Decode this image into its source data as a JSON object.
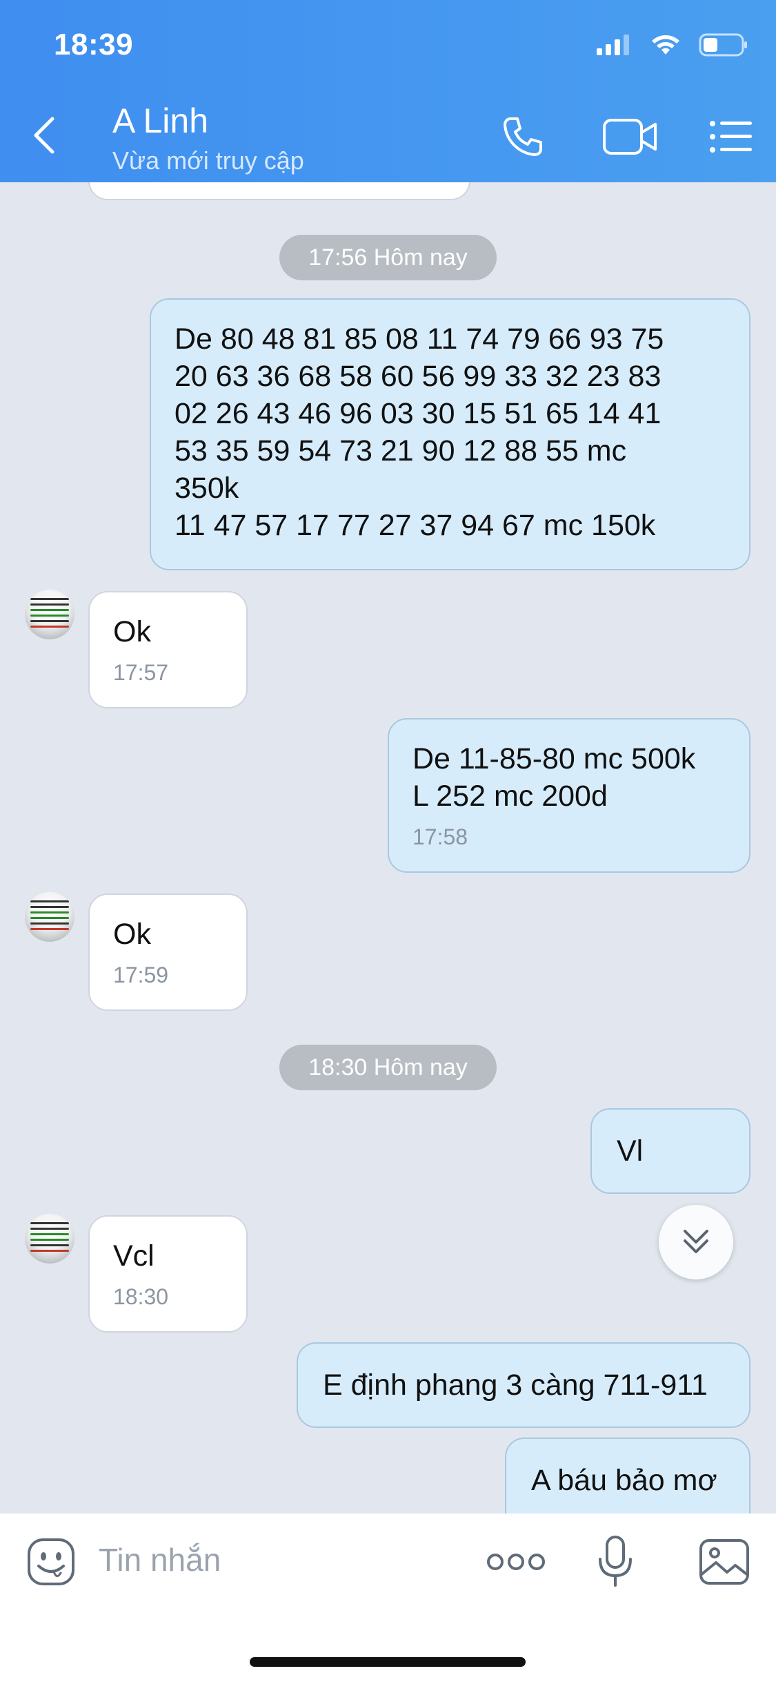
{
  "status_bar": {
    "time": "18:39"
  },
  "header": {
    "name": "A Linh",
    "status": "Vừa mới truy cập"
  },
  "dates": {
    "d1": "17:56 Hôm nay",
    "d2": "18:30 Hôm nay"
  },
  "messages": {
    "m1": {
      "text": "De 80 48 81 85 08 11 74 79 66 93 75\n20 63 36 68 58 60 56 99 33 32 23 83\n02 26 43 46 96 03 30 15 51 65 14 41\n53 35 59 54 73 21 90 12 88 55 mc\n350k\n11 47 57 17 77 27 37 94 67 mc 150k"
    },
    "m2": {
      "text": "Ok",
      "time": "17:57"
    },
    "m3": {
      "text": "De 11-85-80 mc 500k\nL 252 mc 200d",
      "time": "17:58"
    },
    "m4": {
      "text": "Ok",
      "time": "17:59"
    },
    "m5": {
      "text": "Vl"
    },
    "m6": {
      "text": "Vcl",
      "time": "18:30"
    },
    "m7": {
      "text": "E định phang 3 càng 711-911"
    },
    "m8": {
      "text": "A báu bảo mơ"
    }
  },
  "input": {
    "placeholder": "Tin nhắn"
  },
  "icons": {
    "signal": "signal-icon",
    "wifi": "wifi-icon",
    "battery": "battery-icon",
    "back": "back-arrow-icon",
    "call": "phone-icon",
    "video": "video-camera-icon",
    "menu": "list-menu-icon",
    "emoji": "emoji-icon",
    "more": "more-dots-icon",
    "mic": "microphone-icon",
    "image": "image-icon",
    "scroll": "chevron-double-down-icon"
  },
  "colors": {
    "header": "#3f8ef0",
    "outgoing_bubble": "#d6ecfb",
    "incoming_bubble": "#ffffff",
    "chat_bg": "#e2e7ef"
  }
}
